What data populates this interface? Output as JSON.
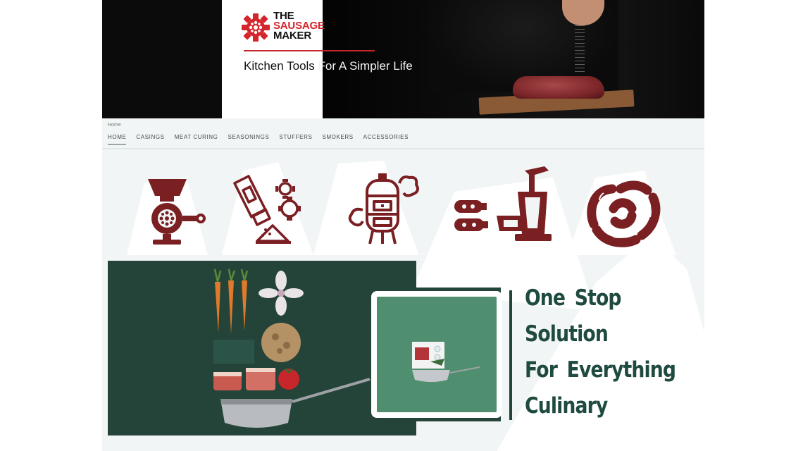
{
  "brand": {
    "logo_line1": "THE",
    "logo_line2": "SAUSAGE",
    "logo_line3": "MAKER",
    "tagline_part1": "Kitchen Tools ",
    "tagline_part2": "For A Simpler Life",
    "accent_color": "#d4252c"
  },
  "breadcrumb": "Home",
  "nav": {
    "items": [
      {
        "label": "HOME"
      },
      {
        "label": "CASINGS"
      },
      {
        "label": "MEAT CURING"
      },
      {
        "label": "SEASONINGS"
      },
      {
        "label": "STUFFERS"
      },
      {
        "label": "SMOKERS"
      },
      {
        "label": "ACCESSORIES"
      }
    ],
    "active": "HOME"
  },
  "category_icons": [
    "meat-grinder-icon",
    "seasoning-shaker-icon",
    "smoker-icon",
    "sausage-stuffer-icon",
    "sausage-links-icon"
  ],
  "promo": {
    "headline_lines": [
      "One Stop",
      "Solution",
      "For Everything",
      "Culinary"
    ],
    "theme_color": "#24443a",
    "headline_color": "#1f4a40"
  },
  "icon_color": "#7a1f22"
}
